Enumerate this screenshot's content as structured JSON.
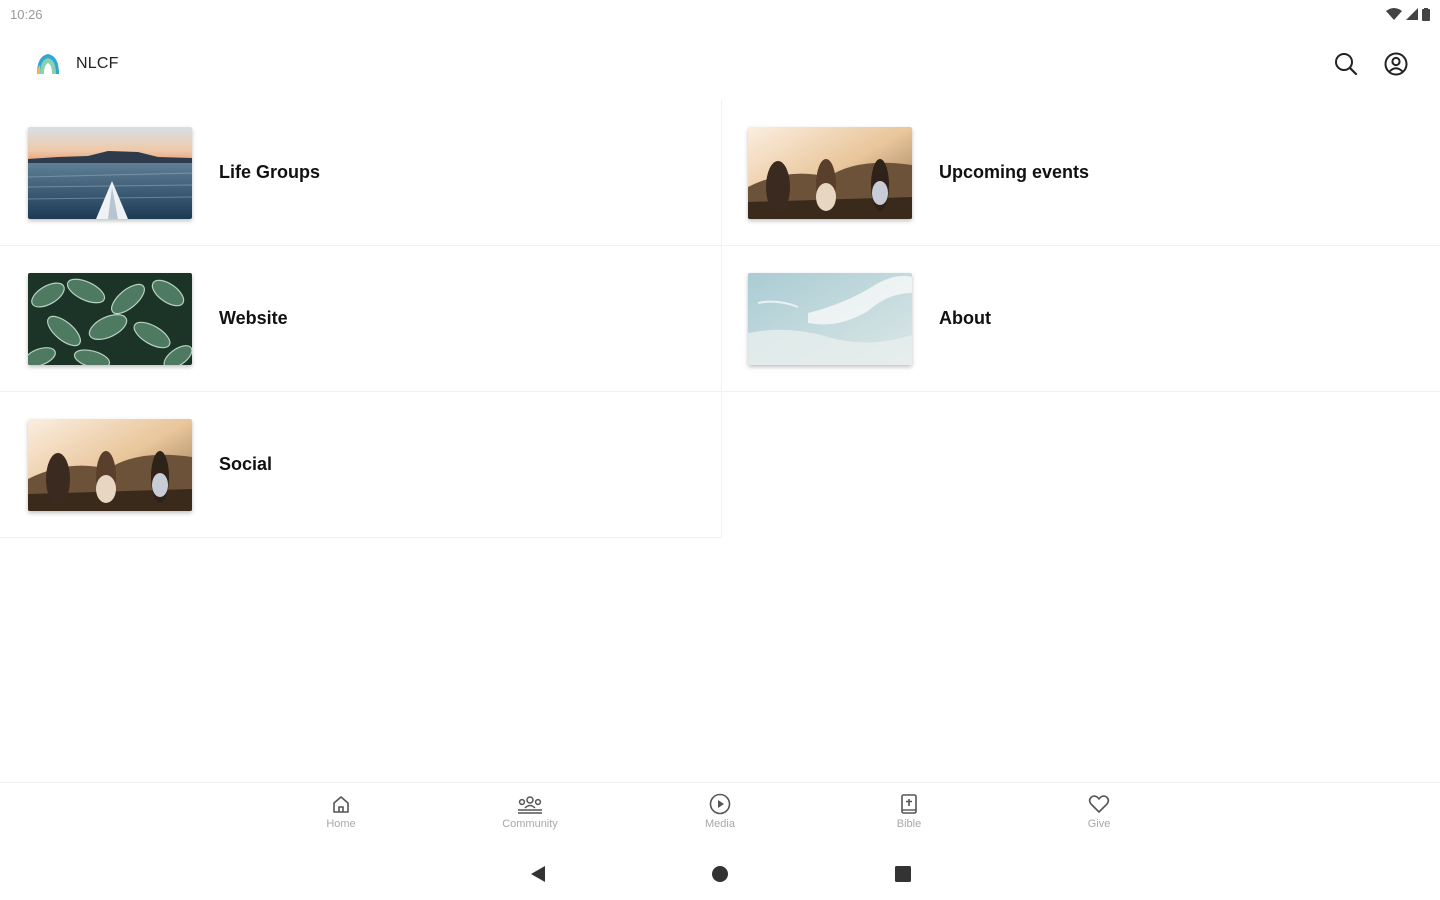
{
  "status_bar": {
    "time": "10:26"
  },
  "app_bar": {
    "title": "NLCF",
    "icons": {
      "search": "search-icon",
      "account": "account-circle-icon"
    }
  },
  "cards": [
    {
      "label": "Life Groups",
      "image": "lake-kayak-sunset"
    },
    {
      "label": "Upcoming events",
      "image": "friends-sunset-hills"
    },
    {
      "label": "Website",
      "image": "green-leaves"
    },
    {
      "label": "About",
      "image": "ocean-waves"
    },
    {
      "label": "Social",
      "image": "friends-sunset-hills"
    }
  ],
  "bottom_nav": {
    "items": [
      {
        "label": "Home",
        "icon": "home-icon"
      },
      {
        "label": "Community",
        "icon": "community-icon"
      },
      {
        "label": "Media",
        "icon": "play-circle-icon"
      },
      {
        "label": "Bible",
        "icon": "bible-icon"
      },
      {
        "label": "Give",
        "icon": "heart-icon"
      }
    ]
  },
  "colors": {
    "background": "#ffffff",
    "text": "#111111",
    "nav_label": "#a8a8a8",
    "divider": "#f1f1f1"
  }
}
